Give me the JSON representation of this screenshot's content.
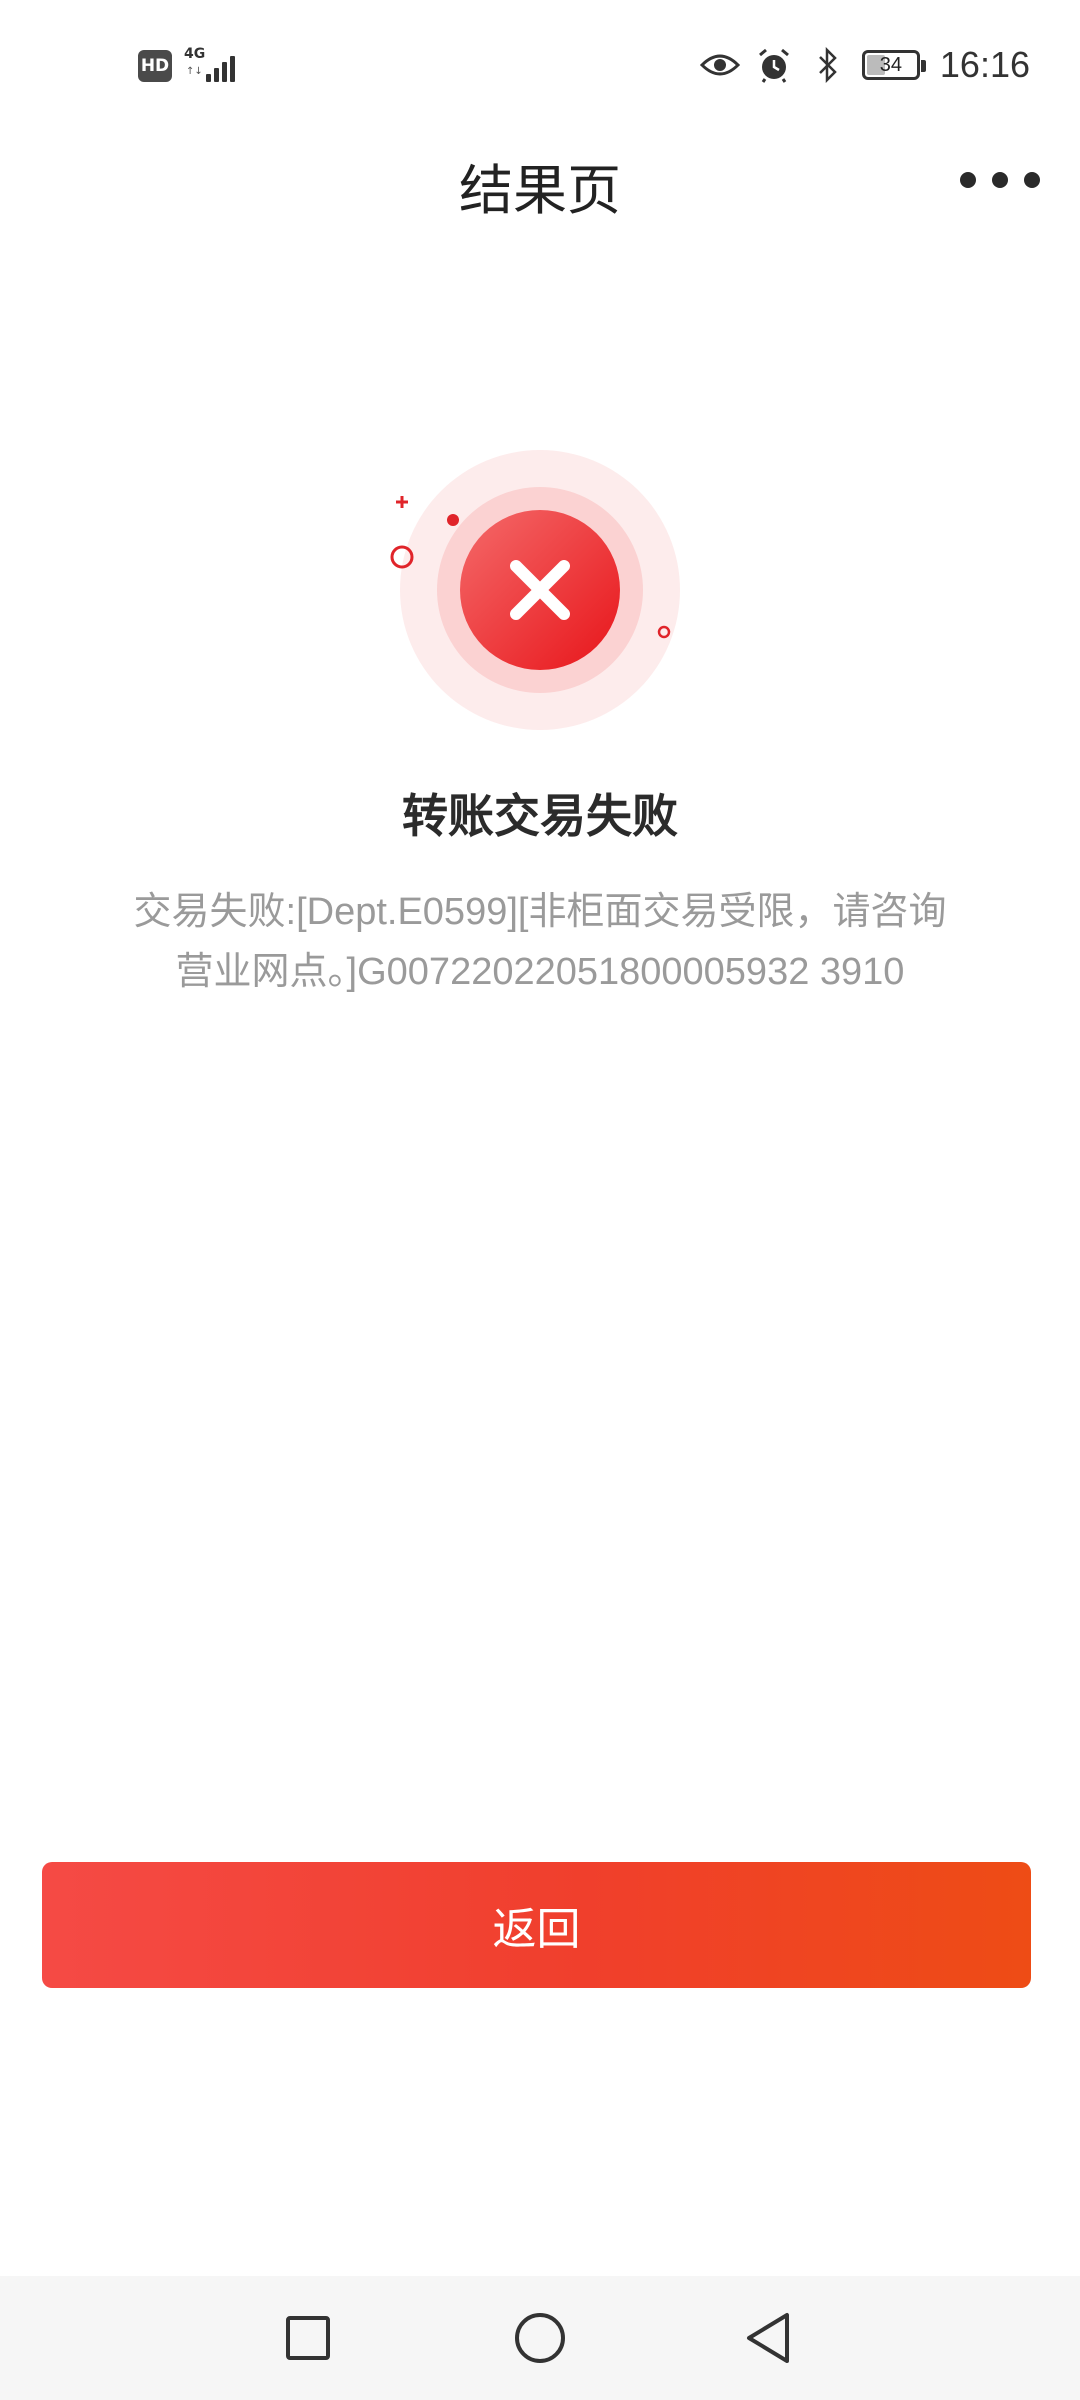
{
  "status_bar": {
    "hd_badge": "HD",
    "network_label": "4G",
    "network_arrows": "↑↓",
    "battery_level": 34,
    "battery_text": "34",
    "time": "16:16",
    "icons": [
      "hd-icon",
      "signal-4g-icon",
      "eye-comfort-icon",
      "alarm-icon",
      "bluetooth-icon",
      "battery-icon"
    ]
  },
  "header": {
    "title": "结果页",
    "more_icon": "more-dots-icon"
  },
  "result": {
    "status": "failure",
    "icon": "close-x-icon",
    "title": "转账交易失败",
    "message": "交易失败:[Dept.E0599][非柜面交易受限，请咨询营业网点。]G00722022051800005932 3910"
  },
  "actions": {
    "return_label": "返回"
  },
  "nav_bar": {
    "icons": [
      "recent-apps-square-icon",
      "home-circle-icon",
      "back-triangle-icon"
    ]
  },
  "colors": {
    "accent_red": "#f0392e",
    "button_gradient_start": "#f54a45",
    "button_gradient_end": "#ee4c15",
    "text_primary": "#222222",
    "text_secondary": "#9a9a9a"
  }
}
